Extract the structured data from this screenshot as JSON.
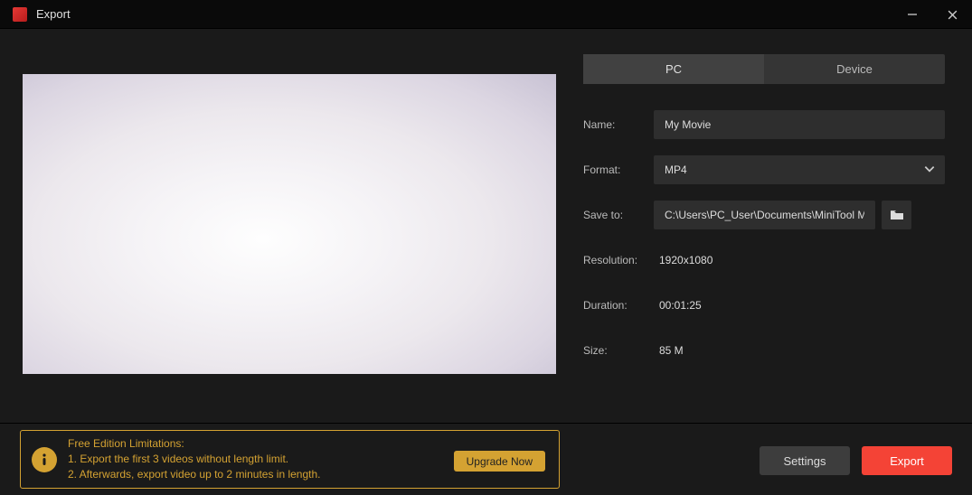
{
  "window": {
    "title": "Export"
  },
  "tabs": {
    "pc": "PC",
    "device": "Device"
  },
  "form": {
    "name_label": "Name:",
    "name_value": "My Movie",
    "format_label": "Format:",
    "format_value": "MP4",
    "saveto_label": "Save to:",
    "saveto_value": "C:\\Users\\PC_User\\Documents\\MiniTool MovieMak",
    "resolution_label": "Resolution:",
    "resolution_value": "1920x1080",
    "duration_label": "Duration:",
    "duration_value": "00:01:25",
    "size_label": "Size:",
    "size_value": "85 M"
  },
  "limitations": {
    "title": "Free Edition Limitations:",
    "line1": "1. Export the first 3 videos without length limit.",
    "line2": "2. Afterwards, export video up to 2 minutes in length.",
    "upgrade": "Upgrade Now"
  },
  "footer": {
    "settings": "Settings",
    "export": "Export"
  }
}
